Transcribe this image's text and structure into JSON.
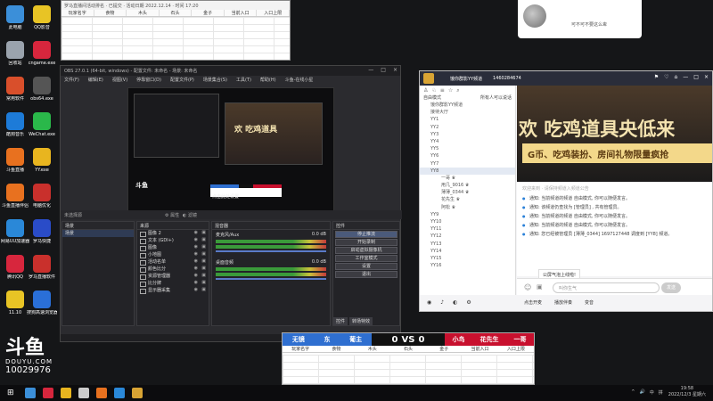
{
  "desktop_icons": [
    {
      "label": "此电脑",
      "color": "#3b8fd9"
    },
    {
      "label": "QQ影音",
      "color": "#e8c425"
    },
    {
      "label": "回收站",
      "color": "#9aa3ad"
    },
    {
      "label": "cngame.exe",
      "color": "#d7263d"
    },
    {
      "label": "常用软件",
      "color": "#d94f2b"
    },
    {
      "label": "obs64.exe",
      "color": "#555555"
    },
    {
      "label": "酷狗音乐",
      "color": "#1d7bd8"
    },
    {
      "label": "WeChat.exe",
      "color": "#2ab84a"
    },
    {
      "label": "斗鱼直播",
      "color": "#e8711f"
    },
    {
      "label": "YY.exe",
      "color": "#e8b51f"
    },
    {
      "label": "斗鱼直播伴侣",
      "color": "#e8711f"
    },
    {
      "label": "电脑优化",
      "color": "#c9302c"
    },
    {
      "label": "网易UU加速器",
      "color": "#2a88d8"
    },
    {
      "label": "罗马快捷",
      "color": "#2a4cc8"
    },
    {
      "label": "腾讯QQ",
      "color": "#d7263d"
    },
    {
      "label": "罗马直播软件",
      "color": "#c9302c"
    },
    {
      "label": "11.10",
      "color": "#e8c425"
    },
    {
      "label": "搜狗高速浏览器",
      "color": "#2a6fd8"
    }
  ],
  "sheet_top": {
    "title": "罗马直播间活动排名 · 已提交 · 活动日期 2022.12.14 · 时间 17:20",
    "headers": [
      "玩家名字",
      "食物",
      "木头",
      "石头",
      "金子",
      "当前入口",
      "入口上限"
    ]
  },
  "obs": {
    "title": "OBS 27.0.1 (64-bit, windows) - 配置文件: 未命名 - 场景: 未命名",
    "menu": [
      "文件(F)",
      "编辑(E)",
      "视图(V)",
      "停靠窗口(D)",
      "配置文件(P)",
      "场景集合(S)",
      "工具(T)",
      "帮助(H)",
      "斗鱼-在线小星"
    ],
    "preview_label": "点击此处设置",
    "no_source": "未选择源",
    "props": "属性",
    "filters": "滤镜",
    "docks": {
      "scenes": "场景",
      "sources": "来源",
      "mixer": "混音器",
      "controls": "控件"
    },
    "scenes": [
      "场景"
    ],
    "sources": [
      "图像 2",
      "文本 (GDI+)",
      "图像",
      "小地图",
      "活动名单",
      "颜色比分",
      "资源管理器",
      "比分牌",
      "显示器采集"
    ],
    "mixer": [
      {
        "name": "麦克风/Aux",
        "db": "0.0 dB"
      },
      {
        "name": "桌面音频",
        "db": "0.0 dB"
      }
    ],
    "controls": [
      "停止推流",
      "开始录制",
      "启动虚拟摄像机",
      "工作室模式",
      "设置",
      "退出"
    ],
    "tabs": [
      "控件",
      "转场特效"
    ],
    "status": "LIVE: 00:00:00   REC: 00:00:00   CPU: 3.1%, 30.00 fps"
  },
  "chat_popup": {
    "message": "可不可不要这么卑"
  },
  "yy": {
    "title": "饿你群影YY频道",
    "channel_id": "1460284674",
    "top_icons": [
      "⚑",
      "♡",
      "⌂",
      "—",
      "□",
      "×"
    ],
    "channels_header": "自由模式",
    "channels_sub": "所有人可以说话",
    "channels": [
      "饿你群影YY频道",
      "接待大厅",
      "YY1",
      "YY2",
      "YY3",
      "YY4",
      "YY5",
      "YY6",
      "YY7",
      "YY8",
      "一哥 ♛",
      "用几_9016 ♛",
      "薄薄_0344 ♛",
      "花先生 ♛",
      "阿松 ♛",
      "YY9",
      "YY10",
      "YY11",
      "YY12",
      "YY13",
      "YY14",
      "YY15",
      "YY16"
    ],
    "banner_big": "欢 吃鸡道具央低来",
    "banner_sub": "G币、吃鸡装扮、房间礼物限量疯抢",
    "welcome": "欢迎来到 · 请保持频道入频道公告",
    "chat_lines": [
      "通知: 当前频道的频道 自由模式, 你可以随便发言。",
      "通知: 该频道仍查找为 [管理员] , 共有管理员。",
      "通知: 当前频道的频道 自由模式, 你可以随便发言。",
      "通知: 当前频道的频道 自由模式, 你可以随便发言。",
      "通知: 您已经被管理员 [薄薄_0344] 1697127448 调度到 [YY8] 频道。"
    ],
    "hint": "公屏气泡上线啦!",
    "input_placeholder": "叫你生气",
    "send": "发送",
    "toolbar": [
      "点击开麦",
      "播放伴奏",
      "变音"
    ]
  },
  "vs": {
    "left_names": [
      "无镜",
      "东",
      "葡主"
    ],
    "left_score": "0",
    "vs_text": "VS",
    "right_score": "0",
    "right_names": [
      "小鸟",
      "花先生",
      "一哥"
    ],
    "headers": [
      "玩家名字",
      "食物",
      "木头",
      "石头",
      "金子",
      "当前入口",
      "入口上限"
    ]
  },
  "logo": {
    "mark": "斗鱼",
    "brand": "DOUYU.COM",
    "room": "10029976"
  },
  "taskbar": {
    "apps": [
      "#3b8fd9",
      "#d7263d",
      "#e8b51f",
      "#cccccc",
      "#e8711f",
      "#2a88d8",
      "#d9a434"
    ],
    "tray_icons": [
      "^",
      "🔊",
      "中",
      "拼"
    ],
    "time": "19:58",
    "date": "2022/12/3 星期六"
  }
}
